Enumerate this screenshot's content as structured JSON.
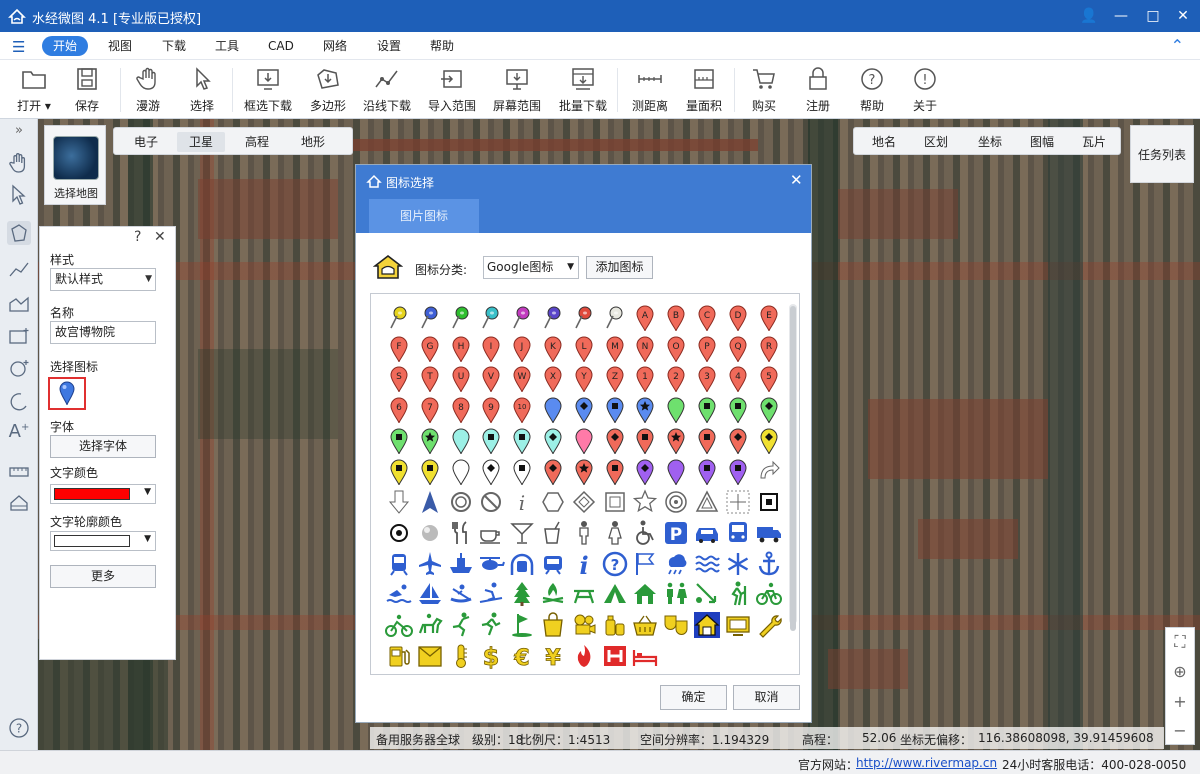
{
  "window": {
    "title": "水经微图 4.1 [专业版已授权]",
    "icons": [
      "user-icon",
      "minimize-icon",
      "maximize-icon",
      "close-icon"
    ]
  },
  "menu": {
    "items": [
      "开始",
      "视图",
      "下载",
      "工具",
      "CAD",
      "网络",
      "设置",
      "帮助"
    ],
    "active": "开始"
  },
  "toolbar": {
    "items": [
      {
        "label": "打开",
        "icon": "folder-icon",
        "dropdown": true
      },
      {
        "label": "保存",
        "icon": "save-icon"
      },
      {
        "label": "漫游",
        "icon": "hand-icon"
      },
      {
        "label": "选择",
        "icon": "cursor-icon"
      },
      {
        "label": "框选下载",
        "icon": "box-download-icon"
      },
      {
        "label": "多边形",
        "icon": "polygon-download-icon"
      },
      {
        "label": "沿线下载",
        "icon": "line-download-icon"
      },
      {
        "label": "导入范围",
        "icon": "import-range-icon"
      },
      {
        "label": "屏幕范围",
        "icon": "screen-range-icon"
      },
      {
        "label": "批量下载",
        "icon": "batch-download-icon"
      },
      {
        "label": "测距离",
        "icon": "measure-distance-icon"
      },
      {
        "label": "量面积",
        "icon": "measure-area-icon"
      },
      {
        "label": "购买",
        "icon": "cart-icon"
      },
      {
        "label": "注册",
        "icon": "lock-icon"
      },
      {
        "label": "帮助",
        "icon": "help-icon"
      },
      {
        "label": "关于",
        "icon": "info-icon"
      }
    ]
  },
  "map": {
    "selector_label": "选择地图",
    "layer_tabs": [
      "电子",
      "卫星",
      "高程",
      "地形"
    ],
    "active_layer": "卫星",
    "right_tabs": [
      "地名",
      "区划",
      "坐标",
      "图幅",
      "瓦片"
    ],
    "task_list": "任务列表"
  },
  "style_panel": {
    "style_label": "样式",
    "style_value": "默认样式",
    "name_label": "名称",
    "name_value": "故宫博物院",
    "icon_label": "选择图标",
    "font_label": "字体",
    "font_button": "选择字体",
    "text_color_label": "文字颜色",
    "text_color": "#ff0000",
    "outline_color_label": "文字轮廓颜色",
    "outline_color": "#ffffff",
    "more_button": "更多"
  },
  "dialog": {
    "title": "图标选择",
    "tab": "图片图标",
    "category_label": "图标分类:",
    "category_value": "Google图标",
    "add_button": "添加图标",
    "ok_button": "确定",
    "cancel_button": "取消",
    "pin_colors": [
      "#e6d41e",
      "#3f5fd6",
      "#2fbf2f",
      "#39c0c9",
      "#c23bbf",
      "#5a45c9",
      "#e04a3c",
      "#e8e8e0"
    ],
    "letter_markers": [
      "A",
      "B",
      "C",
      "D",
      "E",
      "F",
      "G",
      "H",
      "I",
      "J",
      "K",
      "L",
      "M",
      "N",
      "O",
      "P",
      "Q",
      "R",
      "S",
      "T",
      "U",
      "V",
      "W",
      "X",
      "Y",
      "Z",
      "1",
      "2",
      "3",
      "4",
      "5",
      "6",
      "7",
      "8",
      "9",
      "10"
    ],
    "marker_color": "#f06a5a"
  },
  "map_status": {
    "server": "备用服务器全球",
    "level": "级别：18",
    "scale": "比例尺：1:4513",
    "resolution": "空间分辨率：1.194329",
    "elevation_label": "高程：",
    "elevation": "52.06",
    "coord_label": "坐标无偏移：",
    "coords": "116.38608098, 39.91459608"
  },
  "status": {
    "site_label": "官方网站：",
    "site_url": "http://www.rivermap.cn",
    "phone": "24小时客服电话：400-028-0050"
  }
}
